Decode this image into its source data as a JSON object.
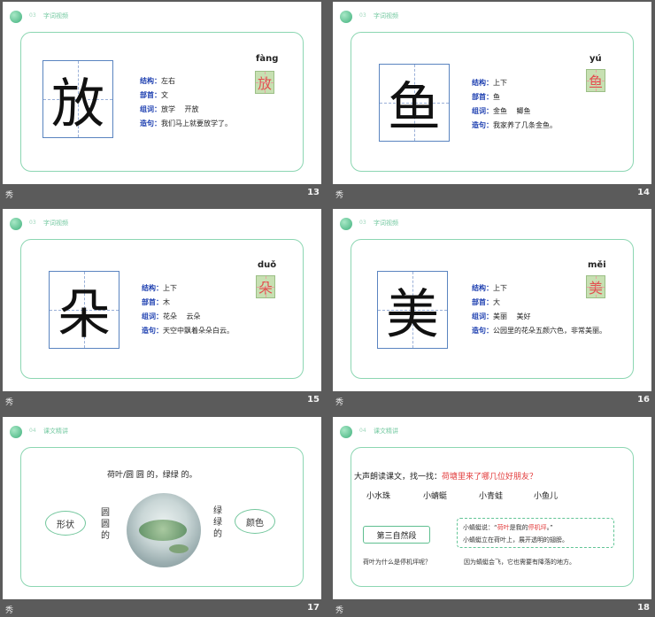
{
  "footer_icon": "秀",
  "slides": [
    {
      "page": "13",
      "header_text": "字词视频",
      "header_small": "03",
      "big_char": "放",
      "pinyin": "fàng",
      "structure_label": "结构：",
      "structure": "左右",
      "radical_label": "部首：",
      "radical": "文",
      "words_label": "组词：",
      "words": "放学　 开放",
      "sentence_label": "造句：",
      "sentence": "我们马上就要放学了。"
    },
    {
      "page": "14",
      "header_text": "字词视频",
      "header_small": "03",
      "big_char": "鱼",
      "pinyin": "yú",
      "structure_label": "结构：",
      "structure": "上下",
      "radical_label": "部首：",
      "radical": "鱼",
      "words_label": "组词：",
      "words": "金鱼　 鲫鱼",
      "sentence_label": "造句：",
      "sentence": "我家养了几条金鱼。"
    },
    {
      "page": "15",
      "header_text": "字词视频",
      "header_small": "03",
      "big_char": "朵",
      "pinyin": "duǒ",
      "structure_label": "结构：",
      "structure": "上下",
      "radical_label": "部首：",
      "radical": "木",
      "words_label": "组词：",
      "words": "花朵　 云朵",
      "sentence_label": "造句：",
      "sentence": "天空中飘着朵朵白云。"
    },
    {
      "page": "16",
      "header_text": "字词视频",
      "header_small": "03",
      "big_char": "美",
      "pinyin": "měi",
      "structure_label": "结构：",
      "structure": "上下",
      "radical_label": "部首：",
      "radical": "大",
      "words_label": "组词：",
      "words": "美丽　 美好",
      "sentence_label": "造句：",
      "sentence": "公园里的花朵五颜六色，非常美丽。"
    }
  ],
  "slide17": {
    "page": "17",
    "header_text": "课文精讲",
    "header_small": "04",
    "top_line": "荷叶/圆 圆 的，绿绿 的。",
    "left_bubble": "形状",
    "right_bubble": "颜色",
    "left_vertical": "圆圆的",
    "right_vertical": "绿绿的"
  },
  "slide18": {
    "page": "18",
    "header_text": "课文精讲",
    "header_small": "04",
    "question_prefix": "大声朗读课文，找一找：",
    "question_red": "荷塘里来了哪几位好朋友？",
    "animals": [
      "小水珠",
      "小蜻蜓",
      "小青蛙",
      "小鱼儿"
    ],
    "para_button": "第三自然段",
    "quote_prefix": "小蜻蜓说：“",
    "quote_red1": "荷叶",
    "quote_mid": "是我的",
    "quote_red2": "停机坪",
    "quote_suffix": "。”",
    "quote_line2": "小蜻蜓立在荷叶上，展开透明的翅膀。",
    "bottom_q": "荷叶为什么是停机坪呢？",
    "bottom_a": "因为蜻蜓会飞，它也需要有降落的地方。"
  }
}
